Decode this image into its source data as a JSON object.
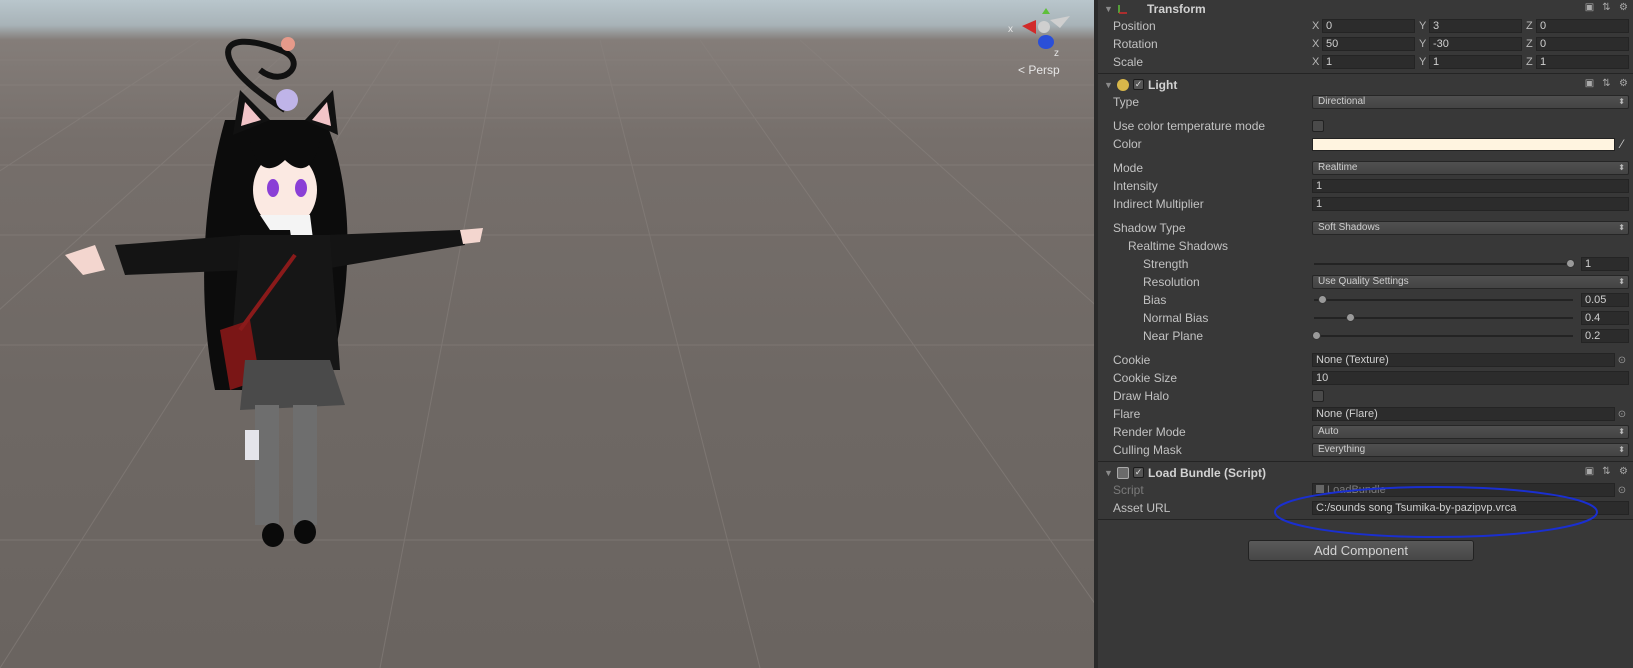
{
  "scene": {
    "projection_label": "Persp",
    "gizmo": {
      "x_label": "x",
      "z_label": "z"
    }
  },
  "transform": {
    "title": "Transform",
    "position": {
      "label": "Position",
      "x": "0",
      "y": "3",
      "z": "0"
    },
    "rotation": {
      "label": "Rotation",
      "x": "50",
      "y": "-30",
      "z": "0"
    },
    "scale": {
      "label": "Scale",
      "x": "1",
      "y": "1",
      "z": "1"
    },
    "axis_x": "X",
    "axis_y": "Y",
    "axis_z": "Z"
  },
  "light": {
    "title": "Light",
    "type": {
      "label": "Type",
      "value": "Directional"
    },
    "color_temp": {
      "label": "Use color temperature mode",
      "checked": false
    },
    "color": {
      "label": "Color",
      "value": "#fff4e0"
    },
    "mode": {
      "label": "Mode",
      "value": "Realtime"
    },
    "intensity": {
      "label": "Intensity",
      "value": "1"
    },
    "indirect": {
      "label": "Indirect Multiplier",
      "value": "1"
    },
    "shadow_type": {
      "label": "Shadow Type",
      "value": "Soft Shadows"
    },
    "realtime_shadows": {
      "label": "Realtime Shadows"
    },
    "strength": {
      "label": "Strength",
      "value": "1",
      "fraction": 1.0
    },
    "resolution": {
      "label": "Resolution",
      "value": "Use Quality Settings"
    },
    "bias": {
      "label": "Bias",
      "value": "0.05",
      "fraction": 0.025
    },
    "normal_bias": {
      "label": "Normal Bias",
      "value": "0.4",
      "fraction": 0.133
    },
    "near_plane": {
      "label": "Near Plane",
      "value": "0.2",
      "fraction": 0.0
    },
    "cookie": {
      "label": "Cookie",
      "value": "None (Texture)"
    },
    "cookie_size": {
      "label": "Cookie Size",
      "value": "10"
    },
    "draw_halo": {
      "label": "Draw Halo",
      "checked": false
    },
    "flare": {
      "label": "Flare",
      "value": "None (Flare)"
    },
    "render_mode": {
      "label": "Render Mode",
      "value": "Auto"
    },
    "culling_mask": {
      "label": "Culling Mask",
      "value": "Everything"
    }
  },
  "load_bundle": {
    "title": "Load Bundle (Script)",
    "script": {
      "label": "Script",
      "value": "LoadBundle"
    },
    "asset_url": {
      "label": "Asset URL",
      "value": "C:/sounds song Tsumika-by-pazipvp.vrca"
    }
  },
  "add_component": "Add Component",
  "colors": {
    "inspector_bg": "#383838",
    "annotation": "#1a2fd0"
  }
}
